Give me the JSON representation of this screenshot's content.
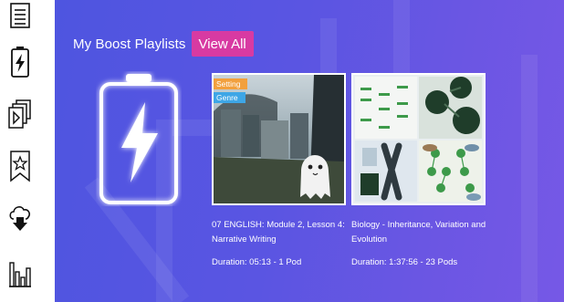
{
  "header": {
    "title": "My Boost Playlists",
    "view_all_label": "View All"
  },
  "colors": {
    "panel_start": "#4e55e0",
    "panel_end": "#7658e6",
    "view_all": "#d83aa2",
    "tag_setting": "#f2a03d",
    "tag_genre": "#3ea6e6"
  },
  "sidebar": {
    "items": [
      {
        "icon": "document-lines-icon"
      },
      {
        "icon": "battery-bolt-icon"
      },
      {
        "icon": "stacked-play-icon"
      },
      {
        "icon": "bookmark-star-icon"
      },
      {
        "icon": "cloud-download-icon"
      },
      {
        "icon": "bar-chart-icon"
      }
    ]
  },
  "playlists": [
    {
      "tags": [
        "Setting",
        "Genre"
      ],
      "title": "07 ENGLISH: Module 2, Lesson 4: Narrative Writing",
      "duration": "Duration: 05:13 - 1 Pod"
    },
    {
      "title": "Biology - Inheritance, Variation and Evolution",
      "duration": "Duration: 1:37:56 - 23 Pods"
    }
  ]
}
